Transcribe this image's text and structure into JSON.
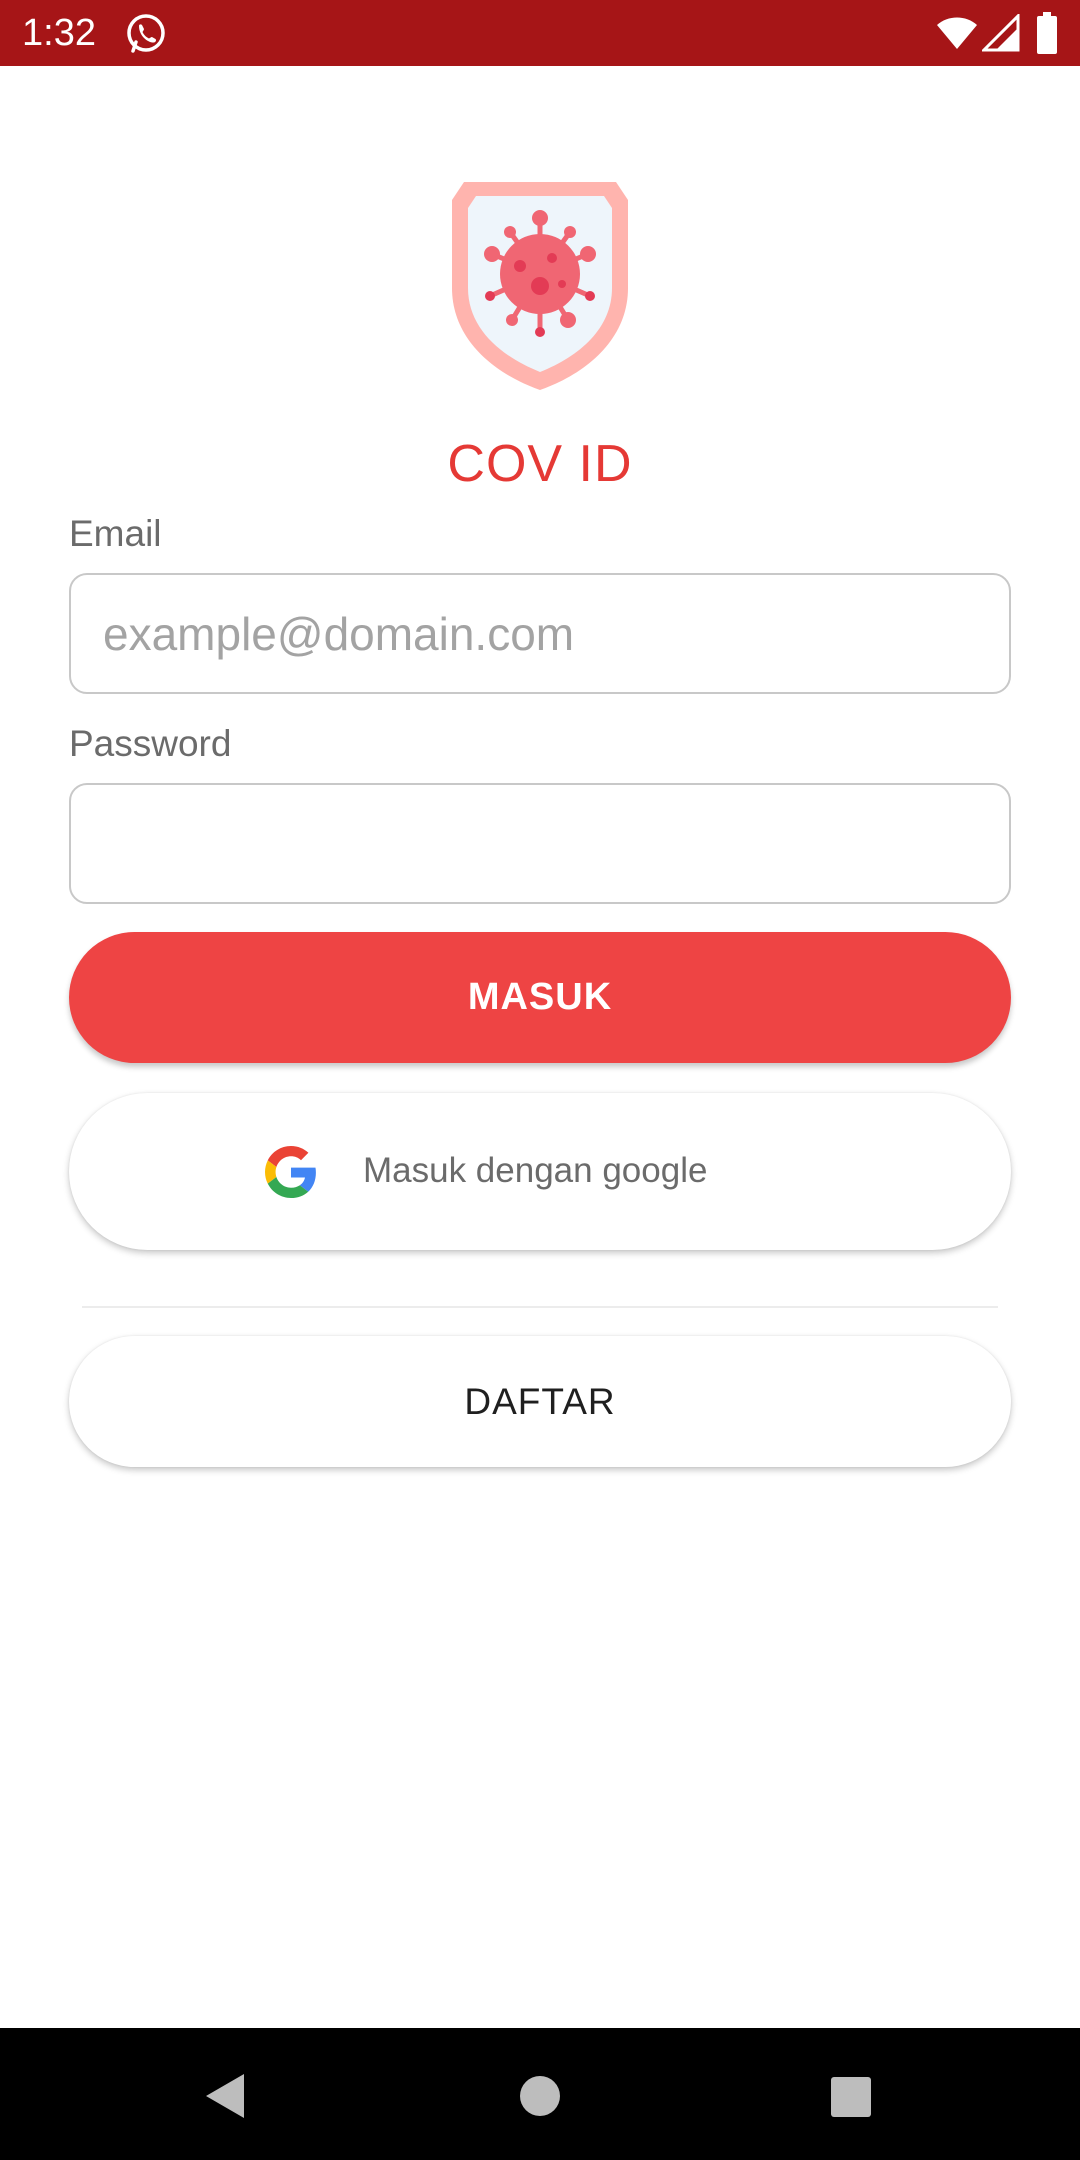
{
  "status_bar": {
    "time": "1:32",
    "icons": [
      "whatsapp-icon",
      "wifi-icon",
      "signal-icon",
      "battery-icon"
    ],
    "background": "#a61517"
  },
  "app": {
    "title": "COV ID",
    "logo": "shield-virus-logo",
    "accent_color": "#e53935"
  },
  "form": {
    "email_label": "Email",
    "email_placeholder": "example@domain.com",
    "email_value": "",
    "password_label": "Password",
    "password_value": ""
  },
  "buttons": {
    "login_label": "MASUK",
    "login_color": "#ee4444",
    "google_label": "Masuk dengan google",
    "google_icon": "google-icon",
    "register_label": "DAFTAR"
  },
  "nav_bar": {
    "icons": [
      "back-icon",
      "home-icon",
      "recents-icon"
    ]
  }
}
